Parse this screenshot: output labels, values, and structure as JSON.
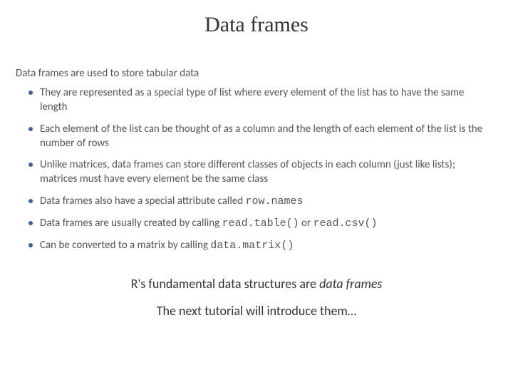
{
  "title": "Data frames",
  "intro": "Data frames are used to store tabular data",
  "bullets": {
    "b0": "They are represented as a special type of list where every element of the list has to have the same length",
    "b1": "Each element of the list can be thought of as a column and the length of each element of the list is the number of rows",
    "b2_pre": "Unlike matrices, data frames can store different classes of objects in each column (just like lists); matrices must have every element be the same class",
    "b3_pre": "Data frames also have a special attribute called ",
    "b3_code": "row.names",
    "b4_pre": "Data frames are usually created by calling ",
    "b4_code1": "read.table()",
    "b4_mid": " or ",
    "b4_code2": "read.csv()",
    "b5_pre": "Can be converted to a matrix by calling ",
    "b5_code": "data.matrix()"
  },
  "subtitle_pre": "R's fundamental data structures are ",
  "subtitle_em": "data frames",
  "footer": "The next tutorial will introduce them…"
}
